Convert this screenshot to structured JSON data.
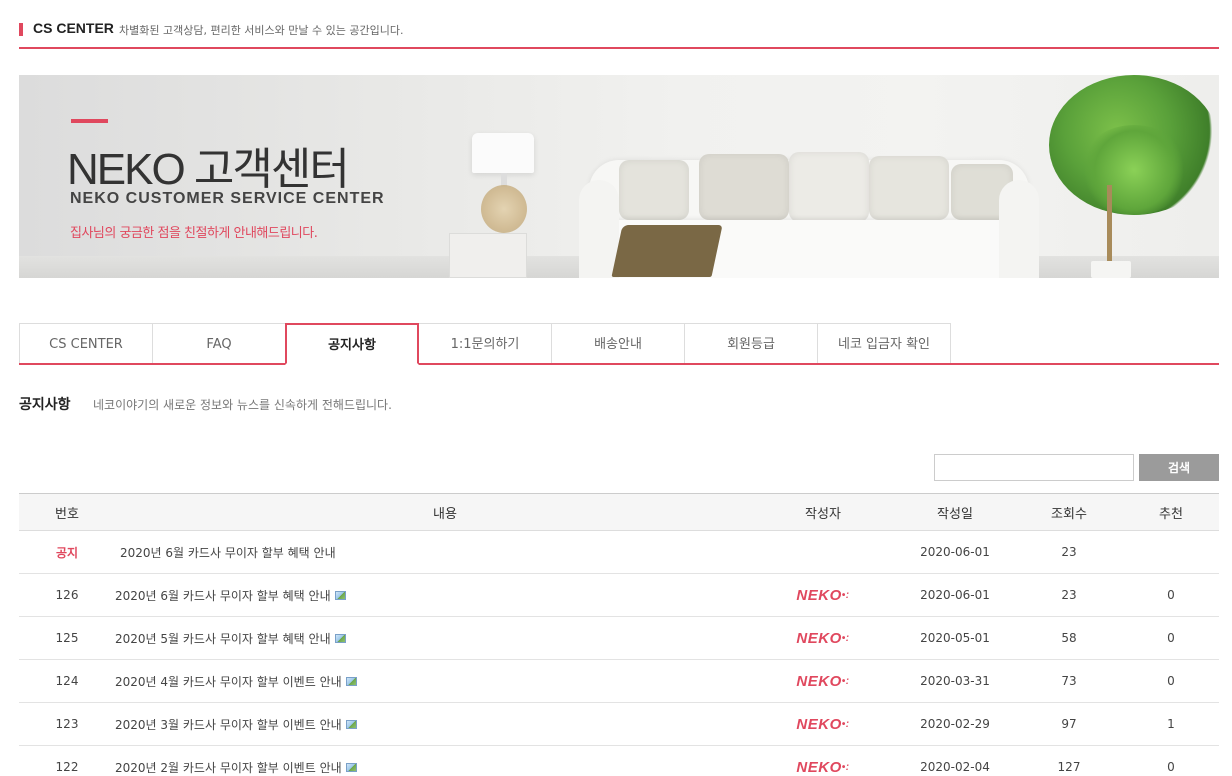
{
  "header": {
    "title": "CS CENTER",
    "desc": "차별화된 고객상담, 편리한 서비스와 만날 수 있는 공간입니다."
  },
  "banner": {
    "title": "NEKO 고객센터",
    "subtitle": "NEKO CUSTOMER SERVICE CENTER",
    "tagline": "집사님의 궁금한 점을 친절하게 안내해드립니다."
  },
  "tabs": [
    {
      "label": "CS CENTER"
    },
    {
      "label": "FAQ"
    },
    {
      "label": "공지사항"
    },
    {
      "label": "1:1문의하기"
    },
    {
      "label": "배송안내"
    },
    {
      "label": "회원등급"
    },
    {
      "label": "네코 입금자 확인"
    }
  ],
  "active_tab": 2,
  "section": {
    "title": "공지사항",
    "desc": "네코이야기의 새로운 정보와 뉴스를 신속하게 전해드립니다."
  },
  "search": {
    "value": "",
    "button": "검색"
  },
  "board": {
    "columns": {
      "num": "번호",
      "subject": "내용",
      "author": "작성자",
      "date": "작성일",
      "views": "조회수",
      "recommend": "추천"
    },
    "notice": {
      "label": "공지",
      "subject": "2020년 6월 카드사 무이자 할부 혜택 안내",
      "date": "2020-06-01",
      "views": "23"
    },
    "author_logo": "NEKO",
    "rows": [
      {
        "num": "126",
        "subject": "2020년 6월 카드사 무이자 할부 혜택 안내",
        "date": "2020-06-01",
        "views": "23",
        "recommend": "0"
      },
      {
        "num": "125",
        "subject": "2020년 5월 카드사 무이자 할부 혜택 안내",
        "date": "2020-05-01",
        "views": "58",
        "recommend": "0"
      },
      {
        "num": "124",
        "subject": "2020년 4월 카드사 무이자 할부 이벤트 안내",
        "date": "2020-03-31",
        "views": "73",
        "recommend": "0"
      },
      {
        "num": "123",
        "subject": "2020년 3월 카드사 무이자 할부 이벤트 안내",
        "date": "2020-02-29",
        "views": "97",
        "recommend": "1"
      },
      {
        "num": "122",
        "subject": "2020년 2월 카드사 무이자 할부 이벤트 안내",
        "date": "2020-02-04",
        "views": "127",
        "recommend": "0"
      }
    ]
  },
  "colors": {
    "accent": "#e0485e",
    "search_button": "#9b9b9b"
  }
}
